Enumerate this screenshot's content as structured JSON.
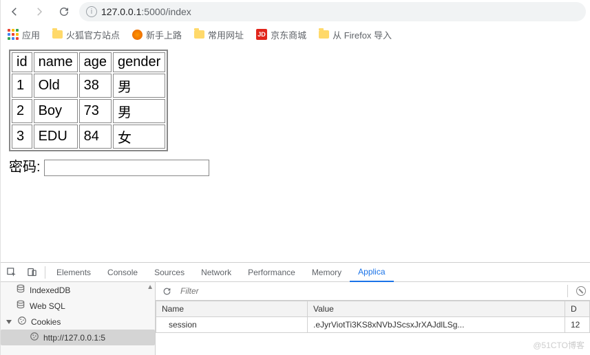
{
  "browser": {
    "url_host": "127.0.0.1",
    "url_port": ":5000",
    "url_path": "/index"
  },
  "bookmarks": {
    "apps": "应用",
    "items": [
      {
        "label": "火狐官方站点",
        "icon": "folder"
      },
      {
        "label": "新手上路",
        "icon": "firefox"
      },
      {
        "label": "常用网址",
        "icon": "folder"
      },
      {
        "label": "京东商城",
        "icon": "jd"
      },
      {
        "label": "从 Firefox 导入",
        "icon": "folder"
      }
    ],
    "jd_text": "JD"
  },
  "table": {
    "headers": [
      "id",
      "name",
      "age",
      "gender"
    ],
    "rows": [
      [
        "1",
        "Old",
        "38",
        "男"
      ],
      [
        "2",
        "Boy",
        "73",
        "男"
      ],
      [
        "3",
        "EDU",
        "84",
        "女"
      ]
    ]
  },
  "password_label": "密码:",
  "devtools": {
    "tabs": [
      "Elements",
      "Console",
      "Sources",
      "Network",
      "Performance",
      "Memory",
      "Applica"
    ],
    "active_tab_index": 6,
    "sidebar": {
      "indexeddb": "IndexedDB",
      "websql": "Web SQL",
      "cookies": "Cookies",
      "cookie_host": "http://127.0.0.1:5"
    },
    "filter_placeholder": "Filter",
    "columns": [
      "Name",
      "Value",
      "D"
    ],
    "cookie_row": {
      "name": "session",
      "value": ".eJyrViotTi3KS8xNVbJScsxJrXAJdlLSg...",
      "d": "12"
    }
  },
  "watermark": "@51CTO博客"
}
